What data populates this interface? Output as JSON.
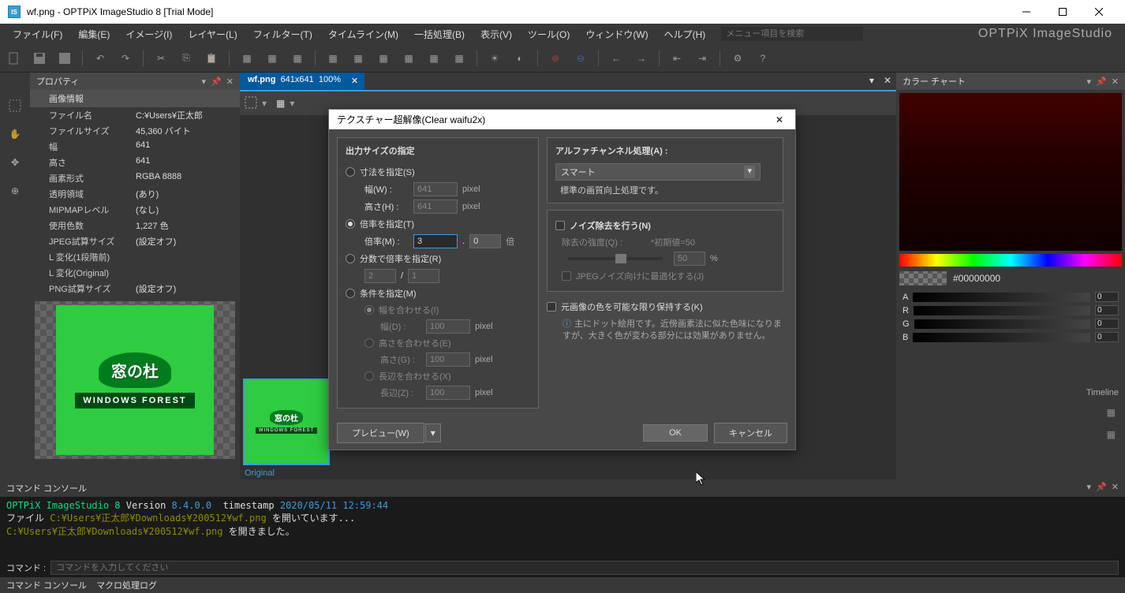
{
  "window": {
    "title": "wf.png - OPTPiX ImageStudio 8 [Trial Mode]",
    "brand": "OPTPiX ImageStudio"
  },
  "menu": {
    "items": [
      "ファイル(F)",
      "編集(E)",
      "イメージ(I)",
      "レイヤー(L)",
      "フィルター(T)",
      "タイムライン(M)",
      "一括処理(B)",
      "表示(V)",
      "ツール(O)",
      "ウィンドウ(W)",
      "ヘルプ(H)"
    ],
    "search_placeholder": "メニュー項目を検索"
  },
  "property_panel": {
    "title": "プロパティ",
    "section": "画像情報",
    "rows": [
      {
        "label": "ファイル名",
        "value": "C:¥Users¥正太郎"
      },
      {
        "label": "ファイルサイズ",
        "value": "45,360 バイト"
      },
      {
        "label": "幅",
        "value": "641"
      },
      {
        "label": "高さ",
        "value": "641"
      },
      {
        "label": "画素形式",
        "value": "RGBA 8888"
      },
      {
        "label": "透明領域",
        "value": "(あり)"
      },
      {
        "label": "MIPMAPレベル",
        "value": "(なし)"
      },
      {
        "label": "使用色数",
        "value": "1,227 色"
      },
      {
        "label": "JPEG試算サイズ",
        "value": "(設定オフ)"
      },
      {
        "label": "L 変化(1段階前)",
        "value": ""
      },
      {
        "label": "L 変化(Original)",
        "value": ""
      },
      {
        "label": "PNG試算サイズ",
        "value": "(設定オフ)"
      }
    ],
    "logo_jp": "窓の杜",
    "logo_en": "WINDOWS FOREST"
  },
  "document": {
    "tab": "wf.png",
    "dims": "641x641",
    "zoom": "100%",
    "original_label": "Original"
  },
  "color_panel": {
    "title": "カラー チャート",
    "hex": "#00000000",
    "channels": [
      "A",
      "R",
      "G",
      "B"
    ],
    "val": "0"
  },
  "timeline": {
    "label": "Timeline"
  },
  "console": {
    "header": "コマンド コンソール",
    "app": "OPTPiX ImageStudio 8",
    "version_label": "Version",
    "version": "8.4.0.0",
    "ts_label": "timestamp",
    "timestamp": "2020/05/11 12:59:44",
    "line2_pre": "ファイル",
    "line2_path": "C:¥Users¥正太郎¥Downloads¥200512¥wf.png",
    "line2_post": "を開いています...",
    "line3_path": "C:¥Users¥正太郎¥Downloads¥200512¥wf.png",
    "line3_post": "を開きました。",
    "cmd_label": "コマンド :",
    "cmd_placeholder": "コマンドを入力してください",
    "tabs": [
      "コマンド コンソール",
      "マクロ処理ログ"
    ]
  },
  "dialog": {
    "title": "テクスチャー超解像(Clear waifu2x)",
    "output_size": "出力サイズの指定",
    "radio_dims": "寸法を指定(S)",
    "width_label": "幅(W) :",
    "width_val": "641",
    "height_label": "高さ(H) :",
    "height_val": "641",
    "radio_scale": "倍率を指定(T)",
    "scale_label": "倍率(M) :",
    "scale_int": "3",
    "scale_dec": "0",
    "scale_unit": "倍",
    "radio_frac": "分数で倍率を指定(R)",
    "frac_num": "2",
    "frac_den": "1",
    "radio_cond": "条件を指定(M)",
    "fit_width": "幅を合わせる(I)",
    "fit_width_label": "幅(D) :",
    "fit_width_val": "100",
    "fit_height": "高さを合わせる(E)",
    "fit_height_label": "高さ(G) :",
    "fit_height_val": "100",
    "fit_long": "長辺を合わせる(X)",
    "fit_long_label": "長辺(Z) :",
    "fit_long_val": "100",
    "pixel": "pixel",
    "alpha_title": "アルファチャンネル処理(A) :",
    "alpha_mode": "スマート",
    "alpha_note": "標準の画質向上処理です。",
    "noise_title": "ノイズ除去を行う(N)",
    "noise_strength": "除去の強度(Q) :",
    "noise_default": "*初期値=50",
    "noise_val": "50",
    "noise_pct": "%",
    "noise_jpeg": "JPEGノイズ向けに最適化する(J)",
    "preserve_colors": "元画像の色を可能な限り保持する(K)",
    "preserve_note": "主にドット絵用です。近傍画素法に似た色味になりますが、大きく色が変わる部分には効果がありません。",
    "preview": "プレビュー(W)",
    "ok": "OK",
    "cancel": "キャンセル"
  }
}
